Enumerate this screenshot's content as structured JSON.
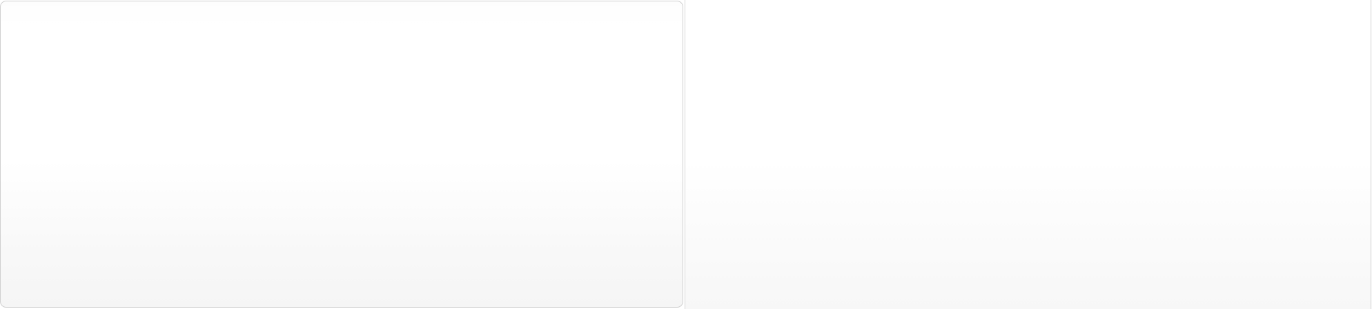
{
  "panels": {
    "left": {
      "content": ""
    },
    "right": {
      "content": ""
    }
  }
}
